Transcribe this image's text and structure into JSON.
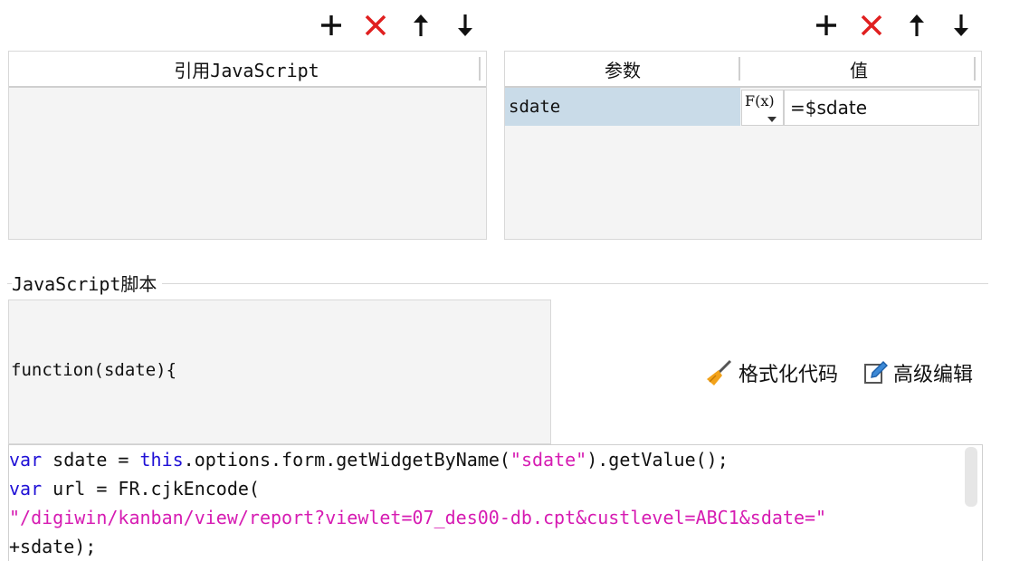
{
  "toolbar_left": {
    "add_label": "+",
    "delete_label": "✕",
    "up_label": "↑",
    "down_label": "↓"
  },
  "toolbar_right": {
    "add_label": "+",
    "delete_label": "✕",
    "up_label": "↑",
    "down_label": "↓"
  },
  "ref_js": {
    "header": "引用JavaScript"
  },
  "params": {
    "col_param": "参数",
    "col_value": "值",
    "rows": [
      {
        "name": "sdate",
        "formula_icon": "F(x)",
        "value": "=$sdate"
      }
    ]
  },
  "script_section": {
    "title": "JavaScript脚本",
    "function_signature": "function(sdate){",
    "format_label": "格式化代码",
    "advanced_label": "高级编辑"
  },
  "code": {
    "line1": {
      "kw1": "var",
      "t1": " sdate = ",
      "kw2": "this",
      "t2": ".options.form.getWidgetByName(",
      "s1": "\"sdate\"",
      "t3": ").getValue();"
    },
    "line2": {
      "kw1": "var",
      "t1": " url = FR.cjkEncode("
    },
    "line3": {
      "s1": "\"/digiwin/kanban/view/report?viewlet=07_des00-db.cpt&custlevel=ABC1&sdate=\""
    },
    "line4": {
      "t1": "+sdate);"
    }
  },
  "colors": {
    "accent_red": "#e02020",
    "keyword_blue": "#1f10d6",
    "string_magenta": "#d61bb2",
    "selected_row": "#c9dbe8"
  }
}
